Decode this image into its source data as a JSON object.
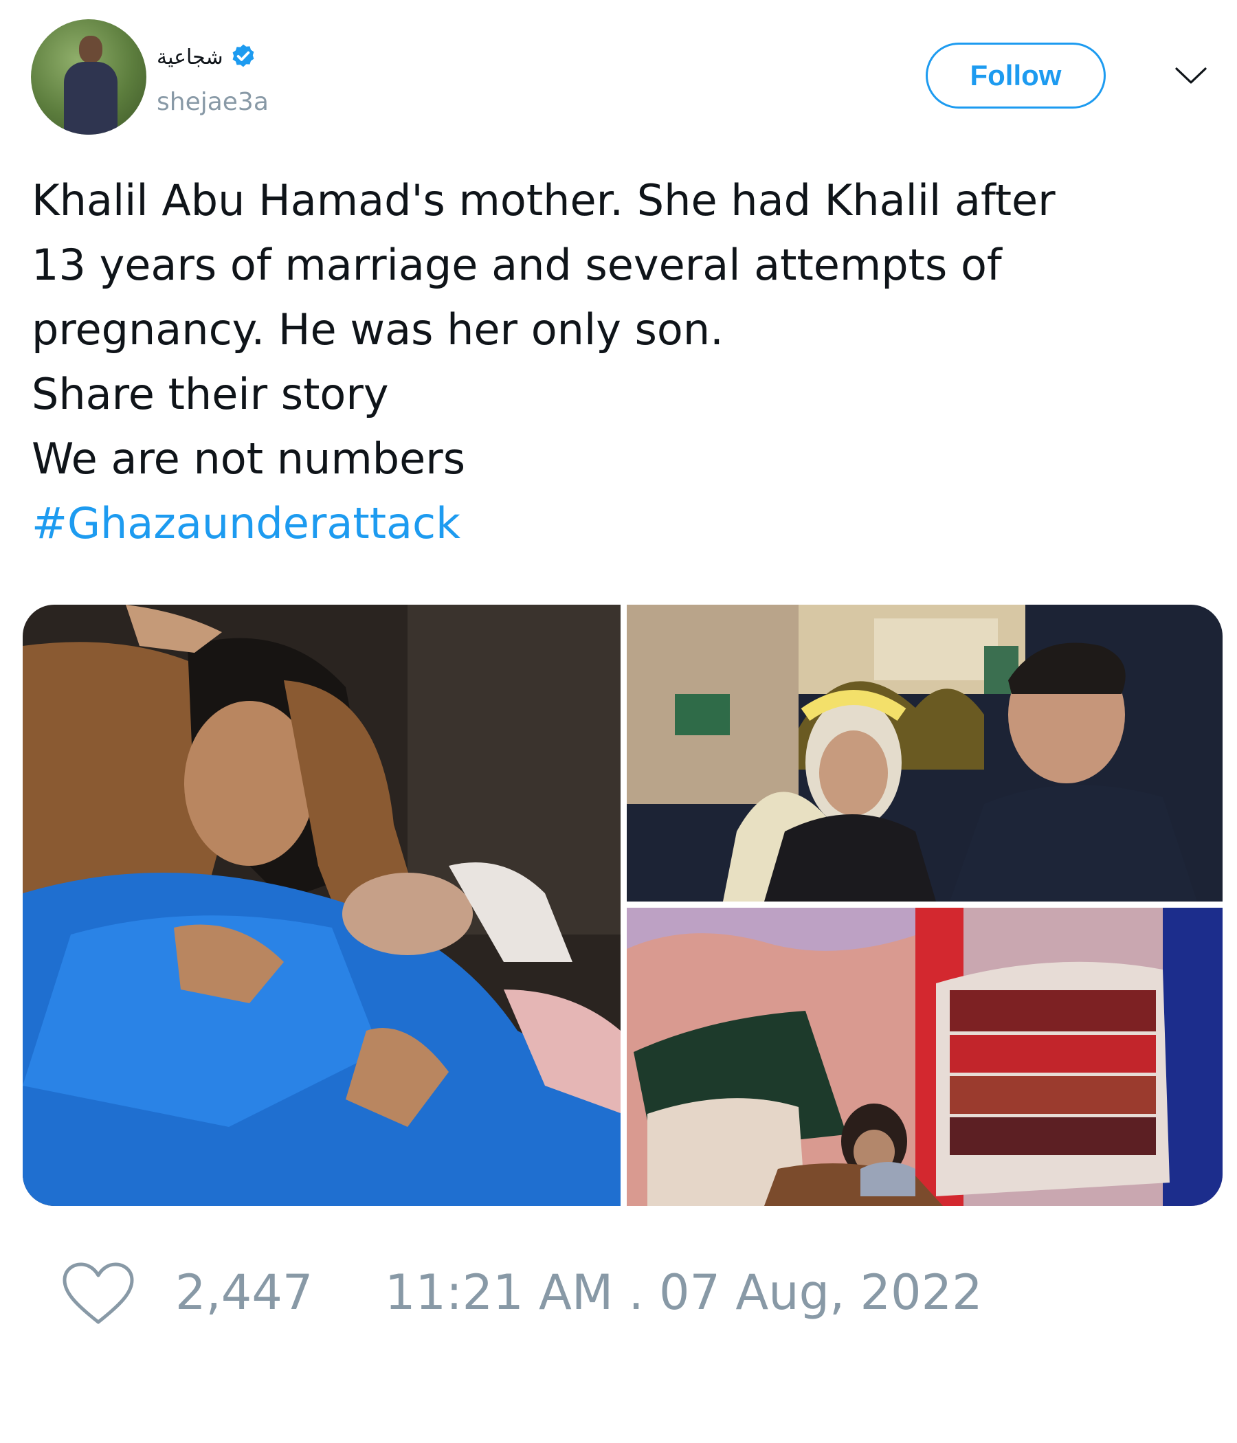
{
  "author": {
    "display_name": "شجاعية",
    "handle": "shejae3a",
    "verified": true,
    "avatar_icon": "user-avatar"
  },
  "header": {
    "follow_label": "Follow",
    "menu_icon": "chevron-down-icon"
  },
  "tweet": {
    "lines": [
      "Khalil Abu Hamad's mother. She had Khalil after",
      "13 years of marriage and several attempts of",
      "pregnancy. He was her only son.",
      "Share their story",
      "We are not numbers"
    ],
    "hashtag": "#Ghazaunderattack"
  },
  "media": {
    "photo_count": 3
  },
  "footer": {
    "like_icon": "heart-icon",
    "like_count": "2,447",
    "timestamp": "11:21 AM . 07 Aug, 2022"
  },
  "colors": {
    "accent": "#1d9bf0",
    "muted": "#8899a6",
    "text": "#0f1419"
  }
}
